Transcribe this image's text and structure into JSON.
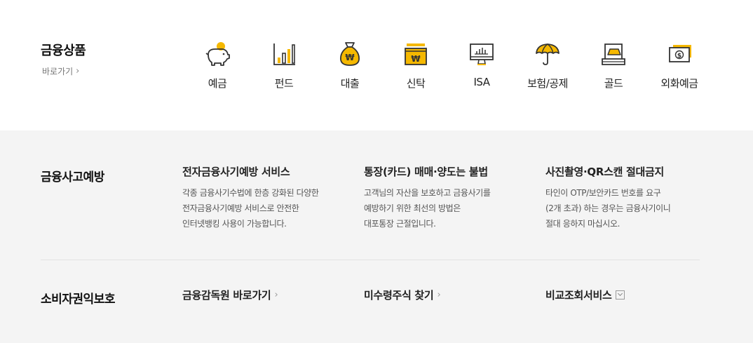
{
  "products_section": {
    "title": "금융상품",
    "link": "바로가기",
    "items": [
      {
        "label": "예금",
        "icon": "piggy-bank-icon"
      },
      {
        "label": "펀드",
        "icon": "bar-chart-icon"
      },
      {
        "label": "대출",
        "icon": "money-bag-icon"
      },
      {
        "label": "신탁",
        "icon": "trust-box-icon"
      },
      {
        "label": "ISA",
        "icon": "monitor-chart-icon"
      },
      {
        "label": "보험/공제",
        "icon": "umbrella-icon"
      },
      {
        "label": "골드",
        "icon": "gold-bar-icon"
      },
      {
        "label": "외화예금",
        "icon": "foreign-cash-icon"
      }
    ]
  },
  "fraud_section": {
    "title": "금융사고예방",
    "columns": [
      {
        "title": "전자금융사기예방 서비스",
        "lines": [
          "각종 금융사기수법에 한층 강화된 다양한",
          "전자금융사기예방 서비스로 안전한",
          "인터넷뱅킹 사용이 가능합니다."
        ]
      },
      {
        "title": "통장(카드) 매매·양도는 불법",
        "lines": [
          "고객님의 자산을 보호하고 금융사기를",
          "예방하기 위한 최선의 방법은",
          "대포통장 근절입니다."
        ]
      },
      {
        "title": "사진촬영·QR스캔 절대금지",
        "lines": [
          "타인이 OTP/보안카드 번호를 요구",
          "(2개 초과) 하는 경우는 금융사기이니",
          "절대 응하지 마십시오."
        ]
      }
    ]
  },
  "consumer_section": {
    "title": "소비자권익보호",
    "links": [
      {
        "label": "금융감독원 바로가기"
      },
      {
        "label": "미수령주식 찾기"
      },
      {
        "label": "비교조회서비스"
      }
    ]
  },
  "colors": {
    "accent": "#f5b800",
    "icon_stroke": "#333333",
    "bottom_bg": "#f4f4f4"
  }
}
